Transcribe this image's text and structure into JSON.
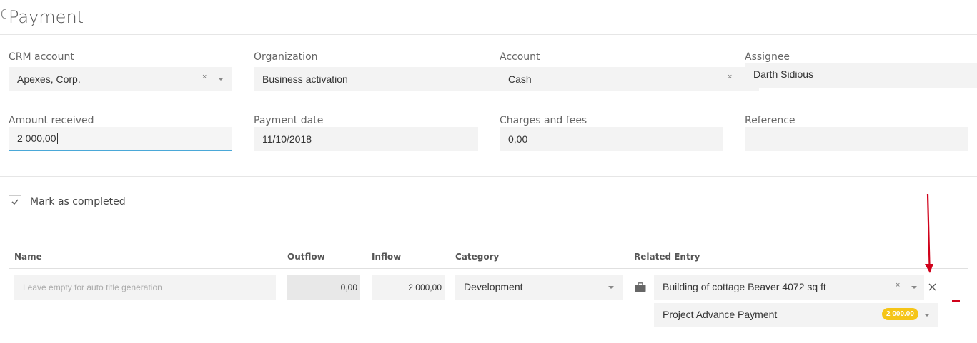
{
  "page": {
    "title": "Payment"
  },
  "fields": {
    "crm_account": {
      "label": "CRM account",
      "value": "Apexes, Corp."
    },
    "organization": {
      "label": "Organization",
      "value": "Business activation"
    },
    "account": {
      "label": "Account",
      "value": "Cash"
    },
    "assignee": {
      "label": "Assignee",
      "value": "Darth Sidious"
    },
    "amount_received": {
      "label": "Amount received",
      "value": "2 000,00"
    },
    "payment_date": {
      "label": "Payment date",
      "value": "11/10/2018"
    },
    "charges_fees": {
      "label": "Charges and fees",
      "value": "0,00"
    },
    "reference": {
      "label": "Reference",
      "value": ""
    }
  },
  "completed": {
    "label": "Mark as completed",
    "checked": true
  },
  "table": {
    "headers": {
      "name": "Name",
      "outflow": "Outflow",
      "inflow": "Inflow",
      "category": "Category",
      "related": "Related Entry"
    },
    "row": {
      "name_placeholder": "Leave empty for auto title generation",
      "outflow": "0,00",
      "inflow": "2 000,00",
      "category": "Development",
      "related_entry": "Building of cottage Beaver 4072 sq ft",
      "sub_entry": "Project Advance Payment",
      "sub_badge": "2 000.00"
    }
  },
  "colors": {
    "accent": "#4aa8d8",
    "badge": "#f5c518",
    "annotation": "#d0021b"
  },
  "icons": {
    "clear": "×",
    "remove": "✕"
  }
}
